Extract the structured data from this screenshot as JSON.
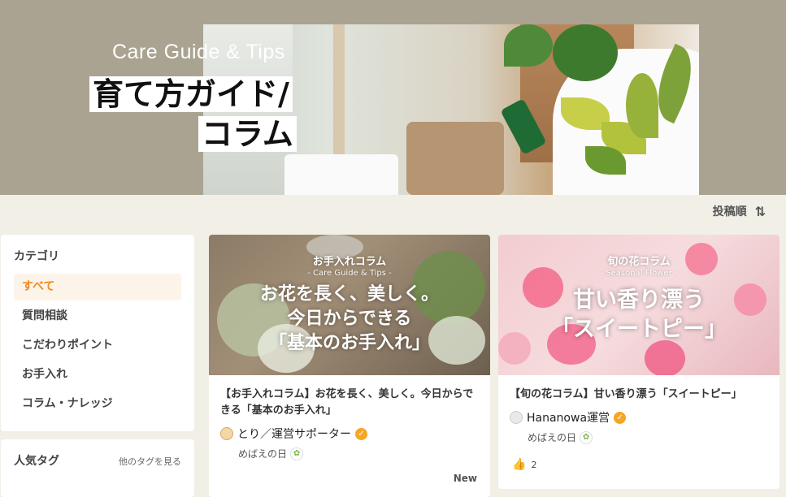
{
  "hero": {
    "subtitle": "Care Guide & Tips",
    "title_line1": "育て方ガイド/",
    "title_line2": "コラム"
  },
  "sort": {
    "label": "投稿順",
    "icon": "sort-arrows-icon"
  },
  "sidebar": {
    "category_title": "カテゴリ",
    "items": [
      {
        "label": "すべて",
        "active": true
      },
      {
        "label": "質問相談",
        "active": false
      },
      {
        "label": "こだわりポイント",
        "active": false
      },
      {
        "label": "お手入れ",
        "active": false
      },
      {
        "label": "コラム・ナレッジ",
        "active": false
      }
    ],
    "tags_title": "人気タグ",
    "tags_link": "他のタグを見る"
  },
  "cards": [
    {
      "thumb_category": "お手入れコラム",
      "thumb_sub": "- Care Guide & Tips -",
      "thumb_main": "お花を長く、美しく。\n今日からできる\n「基本のお手入れ」",
      "title": "【お手入れコラム】お花を長く、美しく。今日からできる「基本のお手入れ」",
      "author": "とり／運営サポーター",
      "level": "めばえの日",
      "badge": "New"
    },
    {
      "thumb_category": "旬の花コラム",
      "thumb_sub": "- Seasonal Flower -",
      "thumb_main": "甘い香り漂う\n「スイートピー」",
      "title": "【旬の花コラム】甘い香り漂う「スイートピー」",
      "author": "Hananowa運営",
      "level": "めばえの日",
      "likes": "2"
    }
  ],
  "colors": {
    "accent": "#f08a24",
    "hero_bg": "#aaa391",
    "page_bg": "#f1efe6",
    "verified": "#f5a623"
  }
}
